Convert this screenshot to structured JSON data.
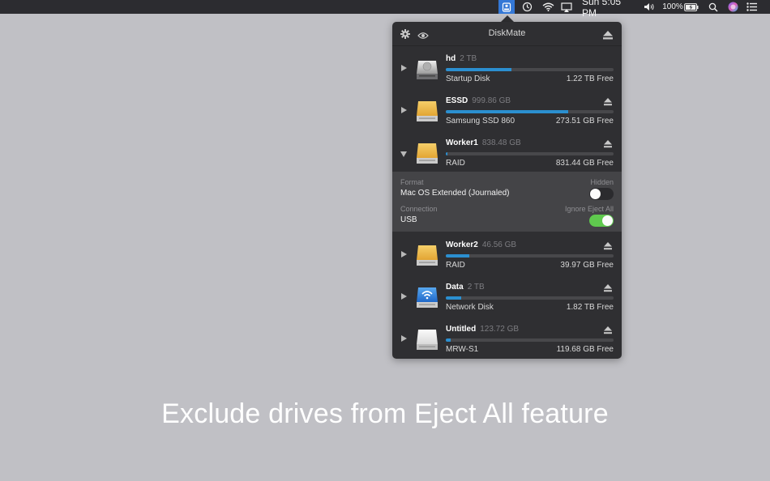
{
  "menubar": {
    "clock": "Sun 5:05 PM",
    "battery": "100%",
    "icons": [
      "diskmate-icon",
      "time-machine-icon",
      "wifi-icon",
      "airplay-icon",
      "volume-icon",
      "battery-icon",
      "spotlight-icon",
      "siri-icon",
      "notification-center-icon"
    ]
  },
  "popover": {
    "title": "DiskMate",
    "header_icons": [
      "gear-icon",
      "eye-icon",
      "eject-all-icon"
    ]
  },
  "drives": [
    {
      "name": "hd",
      "size": "2 TB",
      "subtitle": "Startup Disk",
      "free": "1.22 TB Free",
      "used": 0.39,
      "icon": "internal-hdd-icon",
      "ejectable": false,
      "expanded": false
    },
    {
      "name": "ESSD",
      "size": "999.86 GB",
      "subtitle": "Samsung SSD 860",
      "free": "273.51 GB Free",
      "used": 0.73,
      "icon": "external-drive-icon",
      "ejectable": true,
      "expanded": false
    },
    {
      "name": "Worker1",
      "size": "838.48 GB",
      "subtitle": "RAID",
      "free": "831.44 GB Free",
      "used": 0.01,
      "icon": "external-drive-icon",
      "ejectable": true,
      "expanded": true
    },
    {
      "name": "Worker2",
      "size": "46.56 GB",
      "subtitle": "RAID",
      "free": "39.97 GB Free",
      "used": 0.14,
      "icon": "external-drive-icon",
      "ejectable": true,
      "expanded": false
    },
    {
      "name": "Data",
      "size": "2 TB",
      "subtitle": "Network Disk",
      "free": "1.82 TB Free",
      "used": 0.09,
      "icon": "network-drive-icon",
      "ejectable": true,
      "expanded": false
    },
    {
      "name": "Untitled",
      "size": "123.72 GB",
      "subtitle": "MRW-S1",
      "free": "119.68 GB Free",
      "used": 0.03,
      "icon": "usb-drive-icon",
      "ejectable": true,
      "expanded": false
    }
  ],
  "details": {
    "format_label": "Format",
    "format_value": "Mac OS Extended (Journaled)",
    "hidden_label": "Hidden",
    "hidden_on": false,
    "connection_label": "Connection",
    "connection_value": "USB",
    "ignore_label": "Ignore Eject All",
    "ignore_on": true
  },
  "caption": "Exclude drives from Eject All feature",
  "colors": {
    "accent": "#2b8fd0",
    "toggle_on": "#5fc94e",
    "menubar_active": "#3478d6"
  }
}
